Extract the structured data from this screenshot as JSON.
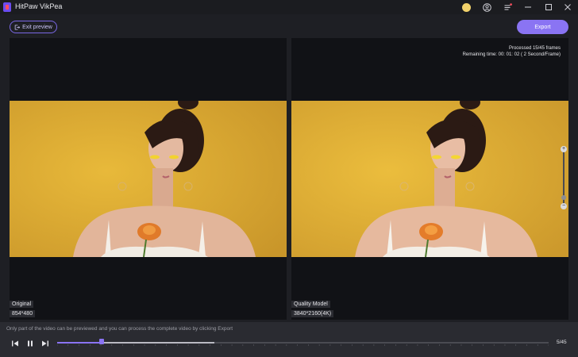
{
  "app": {
    "title": "HitPaw VikPea"
  },
  "titlebar": {
    "icons": [
      "gold-coin-icon",
      "user-icon",
      "menu-icon",
      "minimize-icon",
      "maximize-icon",
      "close-icon"
    ]
  },
  "header": {
    "exit_label": "Exit preview",
    "export_label": "Export"
  },
  "preview": {
    "original": {
      "label": "Original",
      "resolution": "854*480"
    },
    "enhanced": {
      "label": "Quality Model",
      "resolution": "3840*2160(4K)",
      "processed": "Processed 15/45 frames",
      "remaining": "Remaining time: 00: 01: 02 ( 2 Second/Frame)"
    }
  },
  "zoom": {
    "plus": "+",
    "minus": "−",
    "level": 0.2
  },
  "footer": {
    "note": "Only part of the video can be previewed and you can process the complete video by clicking Export",
    "frame_count": "5/45",
    "played_fraction": 0.09,
    "available_fraction": 0.32
  },
  "colors": {
    "accent": "#8a74f3",
    "background": "#1e1f24",
    "panel": "#111216",
    "backdrop": "#deae30"
  }
}
